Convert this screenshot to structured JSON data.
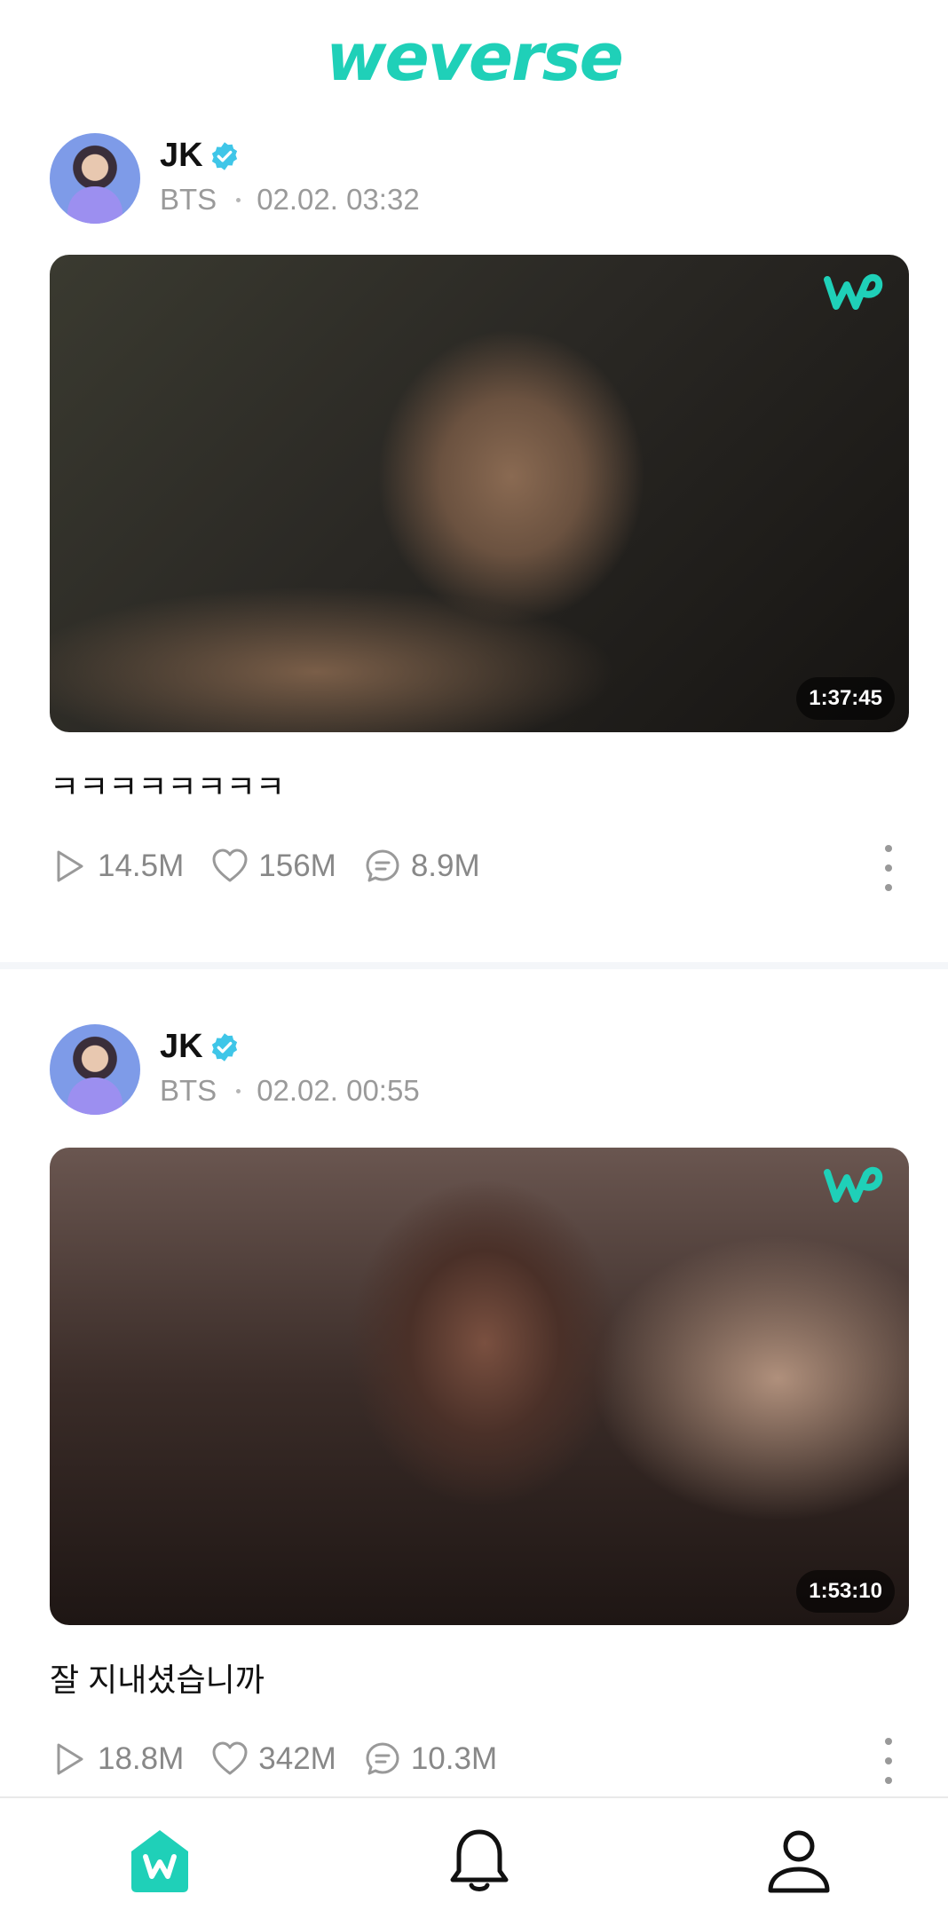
{
  "app": {
    "logo_text": "weverse",
    "brand_color": "#1fd0b8"
  },
  "posts": [
    {
      "author": "JK",
      "group": "BTS",
      "timestamp": "02.02. 03:32",
      "duration": "1:37:45",
      "caption": "ㅋㅋㅋㅋㅋㅋㅋㅋ",
      "stats": {
        "plays": "14.5M",
        "likes": "156M",
        "comments": "8.9M"
      }
    },
    {
      "author": "JK",
      "group": "BTS",
      "timestamp": "02.02. 00:55",
      "duration": "1:53:10",
      "caption": "잘 지내셨습니까",
      "stats": {
        "plays": "18.8M",
        "likes": "342M",
        "comments": "10.3M"
      }
    }
  ],
  "icons": {
    "verified": "verified-badge-icon",
    "play": "play-icon",
    "like": "heart-icon",
    "comment": "comment-icon",
    "more": "more-vertical-icon",
    "home": "home-icon",
    "notifications": "bell-icon",
    "profile": "profile-icon"
  }
}
